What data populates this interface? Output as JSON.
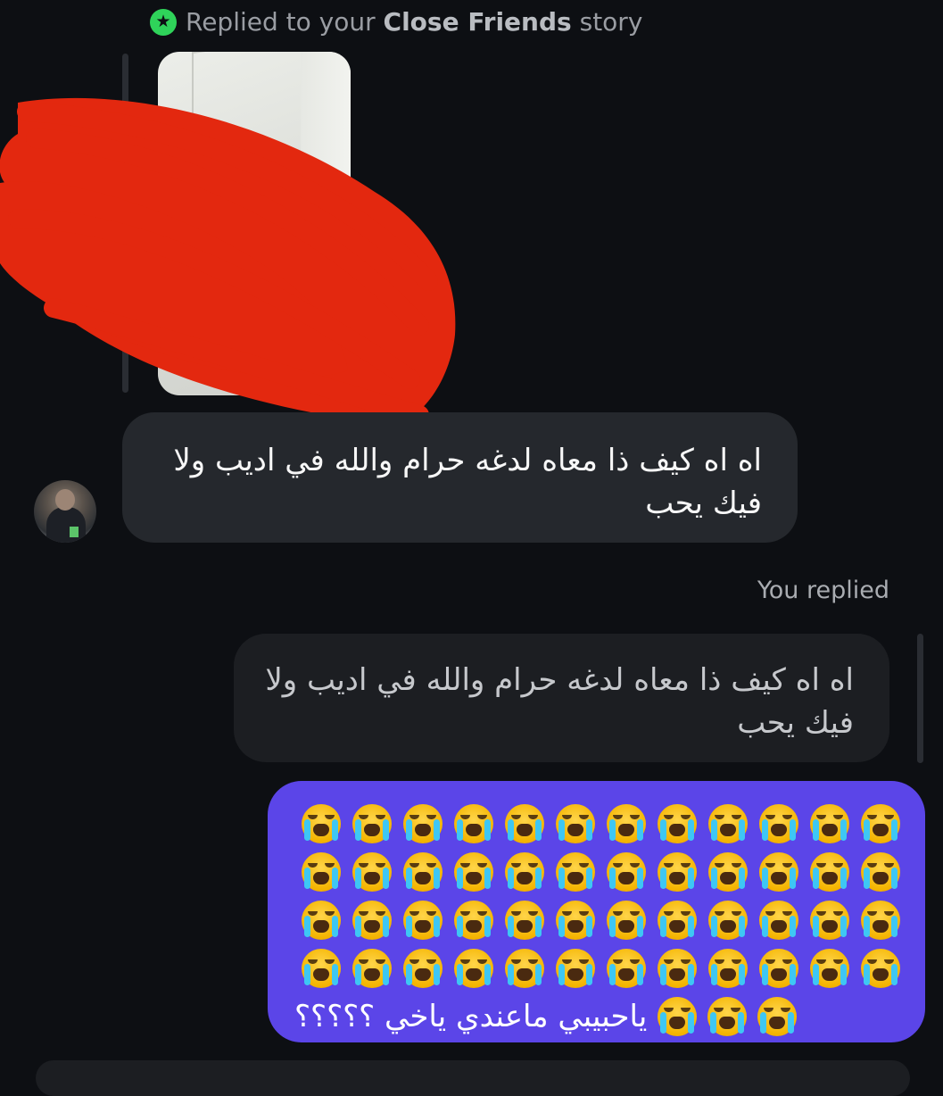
{
  "story_reply": {
    "prefix": "Replied to your",
    "highlight": "Close Friends",
    "suffix": "story"
  },
  "incoming_message": {
    "text": "اه اه كيف ذا معاه لدغه حرام والله في اديب ولا فيك يحب"
  },
  "you_replied_label": "You replied",
  "quoted_message": {
    "text": "اه اه كيف ذا معاه لدغه حرام والله في اديب ولا فيك يحب"
  },
  "outgoing_message": {
    "emoji_name": "loudly-crying-face",
    "emoji_rows": 4,
    "emoji_per_row": 12,
    "trailing_emoji_count": 3,
    "text": "ياحبيبي ماعندي ياخي ؟؟؟؟؟"
  },
  "colors": {
    "background": "#0d0f13",
    "incoming_bubble": "#25282d",
    "outgoing_bubble": "#5b45e8",
    "close_friends_green": "#2fd35a",
    "redaction": "#e3280f"
  }
}
